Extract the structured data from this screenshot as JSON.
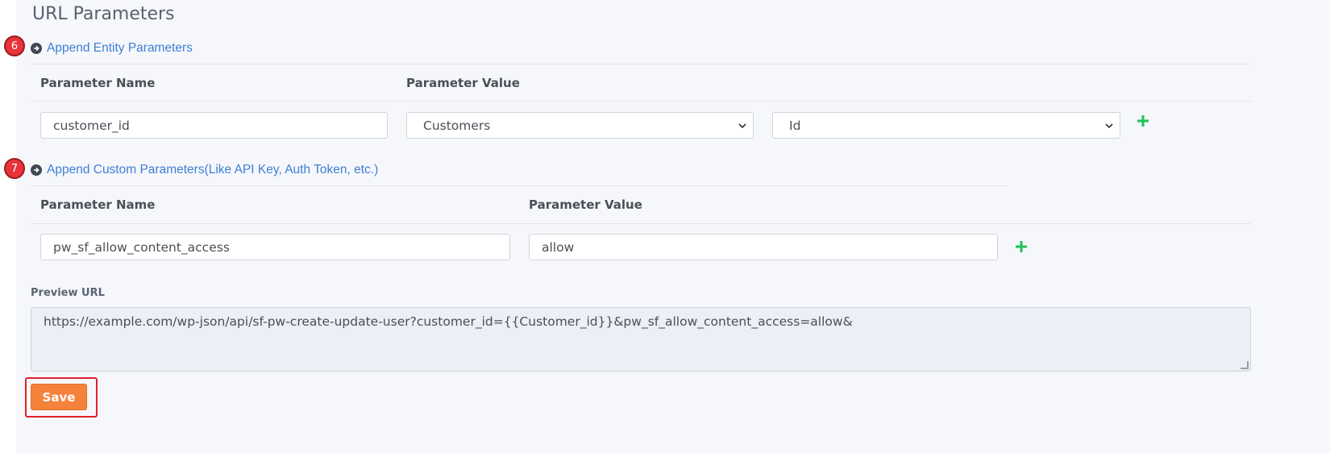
{
  "section_title": "URL Parameters",
  "steps": {
    "entity": "6",
    "custom": "7"
  },
  "entity_section": {
    "link_label": "Append Entity Parameters",
    "headers": {
      "name": "Parameter Name",
      "value": "Parameter Value"
    },
    "row": {
      "name_value": "customer_id",
      "entity_select": "Customers",
      "field_select": "Id"
    }
  },
  "custom_section": {
    "link_label": "Append Custom Parameters(Like API Key, Auth Token, etc.)",
    "headers": {
      "name": "Parameter Name",
      "value": "Parameter Value"
    },
    "row": {
      "name_value": "pw_sf_allow_content_access",
      "value_value": "allow"
    }
  },
  "preview": {
    "label": "Preview URL",
    "url": "https://example.com/wp-json/api/sf-pw-create-update-user?customer_id={{Customer_id}}&pw_sf_allow_content_access=allow&"
  },
  "save_label": "Save",
  "colors": {
    "link": "#3d7fd6",
    "add": "#1fc25a",
    "save": "#f4823a",
    "highlight": "#e0222a",
    "badge": "#e8333a"
  }
}
